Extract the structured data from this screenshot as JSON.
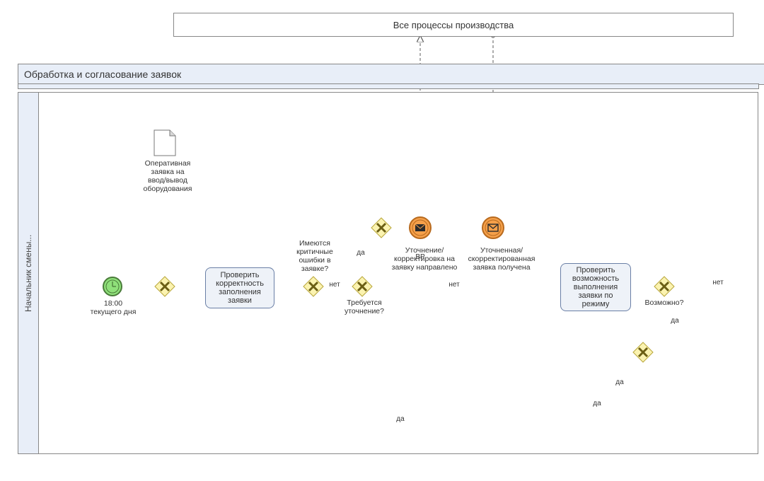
{
  "participant_top": {
    "title": "Все процессы производства"
  },
  "pool": {
    "title": "Обработка и согласование заявок"
  },
  "lane": {
    "title": "Начальник смены..."
  },
  "data_object": {
    "label": "Оперативная\nзаявка на\nввод/вывод\nоборудования"
  },
  "start_event": {
    "label": "18:00\nтекущего дня"
  },
  "task1": {
    "label": "Проверить\nкорректность\nзаполнения\nзаявки"
  },
  "gateway_errors": {
    "label": "Имеются\nкритичные\nошибки в\nзаявке?"
  },
  "gateway_clarify": {
    "label": "Требуется\nуточнение?"
  },
  "msg_send": {
    "label": "Уточнение/\nкорректировка на\nзаявку направлено"
  },
  "msg_recv": {
    "label": "Уточненная/\nскорректированная\nзаявка получена"
  },
  "msg_in": {
    "label": "ВР"
  },
  "task2": {
    "label": "Проверить\nвозможность\nвыполнения\nзаявки по\nрежиму"
  },
  "gateway_possible": {
    "label": "Возможно?"
  },
  "edge": {
    "yes": "да",
    "no": "нет"
  }
}
